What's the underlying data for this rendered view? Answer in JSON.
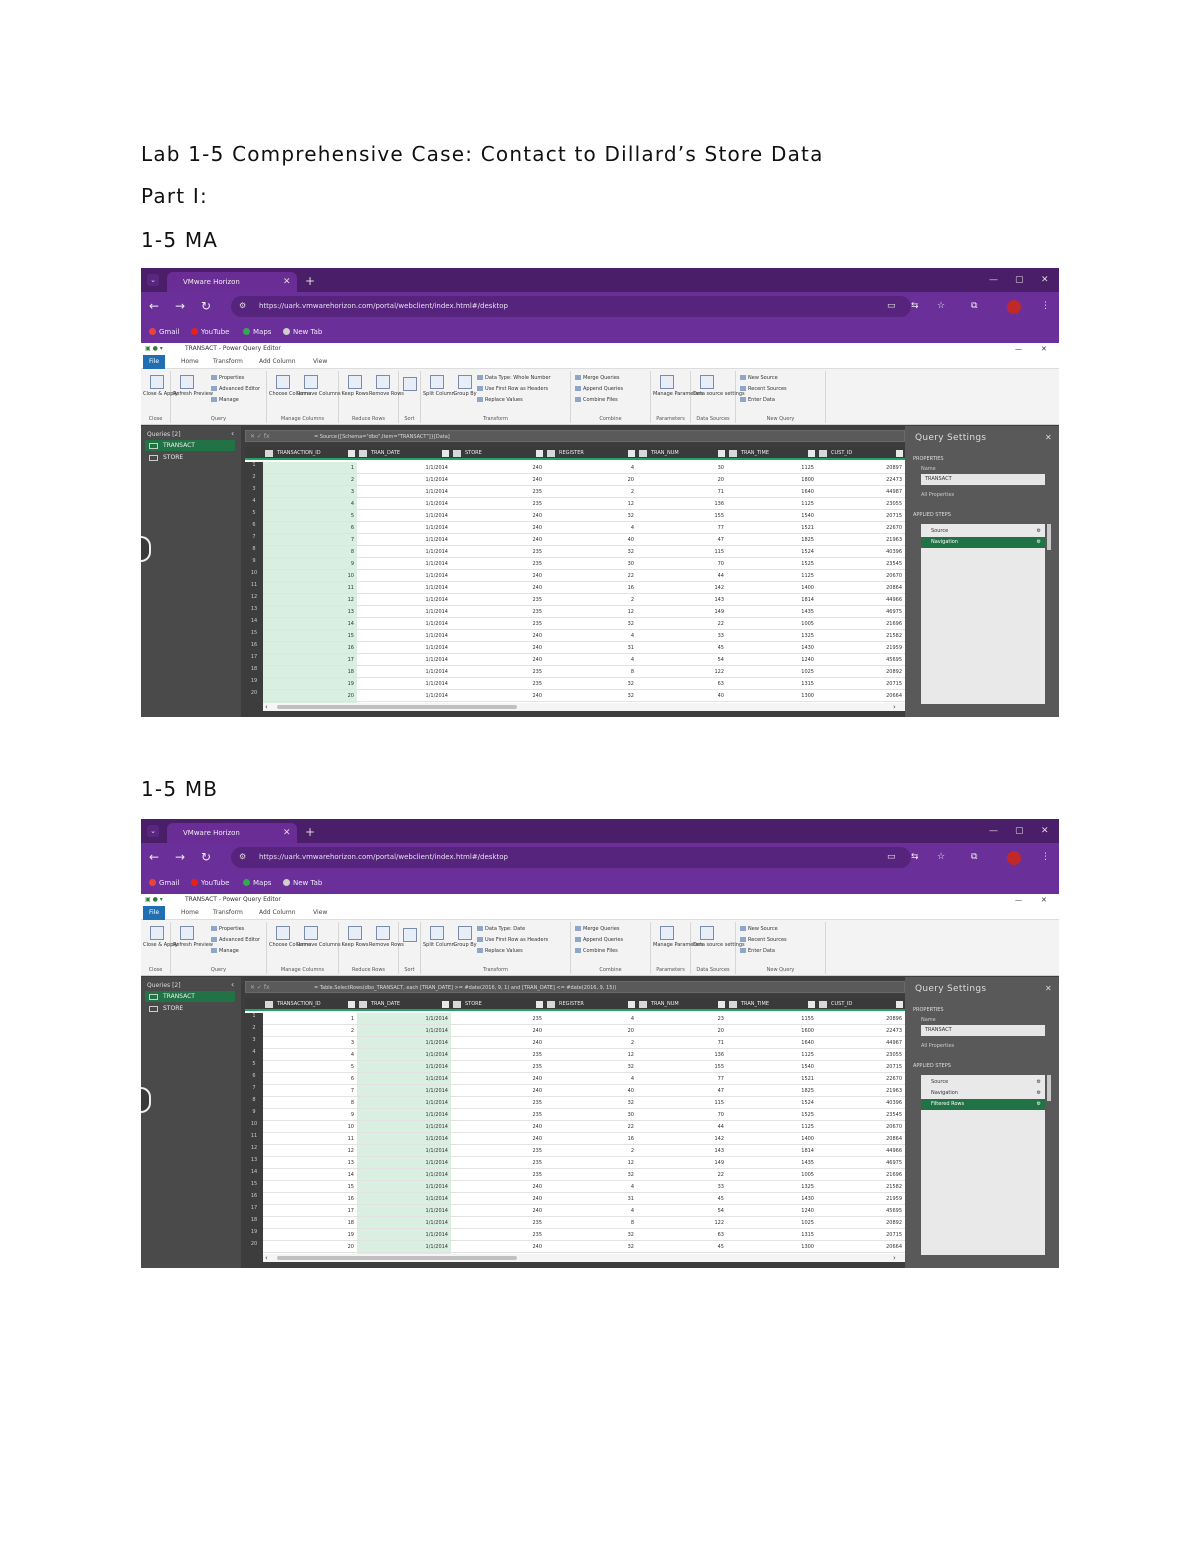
{
  "document": {
    "title": "Lab 1-5 Comprehensive Case: Contact to  Dillard’s Store Data",
    "part": "Part I:",
    "sections": [
      {
        "label": "1-5 MA"
      },
      {
        "label": "1-5 MB"
      }
    ]
  },
  "screenshots": [
    {
      "browser": {
        "tab_title": "VMware Horizon",
        "url": "https://uark.vmwarehorizon.com/portal/webclient/index.html#/desktop",
        "bookmarks": [
          "Gmail",
          "YouTube",
          "Maps",
          "New Tab"
        ]
      },
      "app": {
        "window_title": "TRANSACT - Power Query Editor",
        "ribbon_tabs": [
          "File",
          "Home",
          "Transform",
          "Add Column",
          "View"
        ],
        "ribbon_groups": [
          {
            "label": "Close",
            "buttons": [
              "Close & Apply"
            ]
          },
          {
            "label": "Query",
            "buttons": [
              "Refresh Preview",
              "Properties",
              "Advanced Editor",
              "Manage"
            ]
          },
          {
            "label": "Manage Columns",
            "buttons": [
              "Choose Columns",
              "Remove Columns"
            ]
          },
          {
            "label": "Reduce Rows",
            "buttons": [
              "Keep Rows",
              "Remove Rows"
            ]
          },
          {
            "label": "Sort",
            "buttons": []
          },
          {
            "label": "Transform",
            "buttons": [
              "Split Column",
              "Group By",
              "Data Type: Whole Number",
              "Use First Row as Headers",
              "Replace Values"
            ]
          },
          {
            "label": "Combine",
            "buttons": [
              "Merge Queries",
              "Append Queries",
              "Combine Files"
            ]
          },
          {
            "label": "Parameters",
            "buttons": [
              "Manage Parameters"
            ]
          },
          {
            "label": "Data Sources",
            "buttons": [
              "Data source settings"
            ]
          },
          {
            "label": "New Query",
            "buttons": [
              "New Source",
              "Recent Sources",
              "Enter Data"
            ]
          }
        ],
        "queries_header": "Queries [2]",
        "queries": [
          "TRANSACT",
          "STORE"
        ],
        "selected_query": "TRANSACT",
        "formula": "= Source{[Schema=\"dbo\",Item=\"TRANSACT\"]}[Data]",
        "columns": [
          "TRANSACTION_ID",
          "TRAN_DATE",
          "STORE",
          "REGISTER",
          "TRAN_NUM",
          "TRAN_TIME",
          "CUST_ID"
        ],
        "selected_column": "TRANSACTION_ID",
        "rows": [
          [
            "1",
            "1/1/2014",
            "240",
            "4",
            "30",
            "1125",
            "20897"
          ],
          [
            "2",
            "1/1/2014",
            "240",
            "20",
            "20",
            "1800",
            "22473"
          ],
          [
            "3",
            "1/1/2014",
            "235",
            "2",
            "71",
            "1640",
            "44987"
          ],
          [
            "4",
            "1/1/2014",
            "235",
            "12",
            "136",
            "1125",
            "23055"
          ],
          [
            "5",
            "1/1/2014",
            "240",
            "32",
            "155",
            "1540",
            "20715"
          ],
          [
            "6",
            "1/1/2014",
            "240",
            "4",
            "77",
            "1521",
            "22670"
          ],
          [
            "7",
            "1/1/2014",
            "240",
            "40",
            "47",
            "1825",
            "21963"
          ],
          [
            "8",
            "1/1/2014",
            "235",
            "32",
            "115",
            "1524",
            "40396"
          ],
          [
            "9",
            "1/1/2014",
            "235",
            "30",
            "70",
            "1525",
            "23545"
          ],
          [
            "10",
            "1/1/2014",
            "240",
            "22",
            "44",
            "1125",
            "20670"
          ],
          [
            "11",
            "1/1/2014",
            "240",
            "16",
            "142",
            "1400",
            "20864"
          ],
          [
            "12",
            "1/1/2014",
            "235",
            "2",
            "143",
            "1814",
            "44966"
          ],
          [
            "13",
            "1/1/2014",
            "235",
            "12",
            "149",
            "1435",
            "46975"
          ],
          [
            "14",
            "1/1/2014",
            "235",
            "32",
            "22",
            "1005",
            "21696"
          ],
          [
            "15",
            "1/1/2014",
            "240",
            "4",
            "33",
            "1325",
            "21582"
          ],
          [
            "16",
            "1/1/2014",
            "240",
            "31",
            "45",
            "1430",
            "21959"
          ],
          [
            "17",
            "1/1/2014",
            "240",
            "4",
            "54",
            "1240",
            "45695"
          ],
          [
            "18",
            "1/1/2014",
            "235",
            "8",
            "122",
            "1025",
            "20892"
          ],
          [
            "19",
            "1/1/2014",
            "235",
            "32",
            "63",
            "1315",
            "20715"
          ],
          [
            "20",
            "1/1/2014",
            "240",
            "32",
            "40",
            "1300",
            "20664"
          ]
        ],
        "settings": {
          "title": "Query Settings",
          "properties_label": "PROPERTIES",
          "name_label": "Name",
          "name_value": "TRANSACT",
          "all_properties": "All Properties",
          "applied_steps_label": "APPLIED STEPS",
          "steps": [
            "Source",
            "Navigation"
          ],
          "selected_step": "Navigation"
        }
      }
    },
    {
      "browser": {
        "tab_title": "VMware Horizon",
        "url": "https://uark.vmwarehorizon.com/portal/webclient/index.html#/desktop",
        "bookmarks": [
          "Gmail",
          "YouTube",
          "Maps",
          "New Tab"
        ]
      },
      "app": {
        "window_title": "TRANSACT - Power Query Editor",
        "ribbon_tabs": [
          "File",
          "Home",
          "Transform",
          "Add Column",
          "View"
        ],
        "ribbon_groups": [
          {
            "label": "Close",
            "buttons": [
              "Close & Apply"
            ]
          },
          {
            "label": "Query",
            "buttons": [
              "Refresh Preview",
              "Properties",
              "Advanced Editor",
              "Manage"
            ]
          },
          {
            "label": "Manage Columns",
            "buttons": [
              "Choose Columns",
              "Remove Columns"
            ]
          },
          {
            "label": "Reduce Rows",
            "buttons": [
              "Keep Rows",
              "Remove Rows"
            ]
          },
          {
            "label": "Sort",
            "buttons": []
          },
          {
            "label": "Transform",
            "buttons": [
              "Split Column",
              "Group By",
              "Data Type: Date",
              "Use First Row as Headers",
              "Replace Values"
            ]
          },
          {
            "label": "Combine",
            "buttons": [
              "Merge Queries",
              "Append Queries",
              "Combine Files"
            ]
          },
          {
            "label": "Parameters",
            "buttons": [
              "Manage Parameters"
            ]
          },
          {
            "label": "Data Sources",
            "buttons": [
              "Data source settings"
            ]
          },
          {
            "label": "New Query",
            "buttons": [
              "New Source",
              "Recent Sources",
              "Enter Data"
            ]
          }
        ],
        "queries_header": "Queries [2]",
        "queries": [
          "TRANSACT",
          "STORE"
        ],
        "selected_query": "TRANSACT",
        "formula": "= Table.SelectRows(dbo_TRANSACT, each [TRAN_DATE] >= #date(2016, 9, 1) and [TRAN_DATE] <= #date(2016, 9, 15))",
        "columns": [
          "TRANSACTION_ID",
          "TRAN_DATE",
          "STORE",
          "REGISTER",
          "TRAN_NUM",
          "TRAN_TIME",
          "CUST_ID"
        ],
        "selected_column": "TRAN_DATE",
        "rows": [
          [
            "1",
            "1/1/2014",
            "235",
            "4",
            "23",
            "1155",
            "20896"
          ],
          [
            "2",
            "1/1/2014",
            "240",
            "20",
            "20",
            "1600",
            "22473"
          ],
          [
            "3",
            "1/1/2014",
            "240",
            "2",
            "71",
            "1640",
            "44967"
          ],
          [
            "4",
            "1/1/2014",
            "235",
            "12",
            "136",
            "1125",
            "23055"
          ],
          [
            "5",
            "1/1/2014",
            "235",
            "32",
            "155",
            "1540",
            "20715"
          ],
          [
            "6",
            "1/1/2014",
            "240",
            "4",
            "77",
            "1521",
            "22670"
          ],
          [
            "7",
            "1/1/2014",
            "240",
            "40",
            "47",
            "1825",
            "21963"
          ],
          [
            "8",
            "1/1/2014",
            "235",
            "32",
            "115",
            "1524",
            "40396"
          ],
          [
            "9",
            "1/1/2014",
            "235",
            "30",
            "70",
            "1525",
            "23545"
          ],
          [
            "10",
            "1/1/2014",
            "240",
            "22",
            "44",
            "1125",
            "20670"
          ],
          [
            "11",
            "1/1/2014",
            "240",
            "16",
            "142",
            "1400",
            "20864"
          ],
          [
            "12",
            "1/1/2014",
            "235",
            "2",
            "143",
            "1814",
            "44966"
          ],
          [
            "13",
            "1/1/2014",
            "235",
            "12",
            "149",
            "1435",
            "46975"
          ],
          [
            "14",
            "1/1/2014",
            "235",
            "32",
            "22",
            "1005",
            "21696"
          ],
          [
            "15",
            "1/1/2014",
            "240",
            "4",
            "33",
            "1325",
            "21582"
          ],
          [
            "16",
            "1/1/2014",
            "240",
            "31",
            "45",
            "1430",
            "21959"
          ],
          [
            "17",
            "1/1/2014",
            "240",
            "4",
            "54",
            "1240",
            "45695"
          ],
          [
            "18",
            "1/1/2014",
            "235",
            "8",
            "122",
            "1025",
            "20892"
          ],
          [
            "19",
            "1/1/2014",
            "235",
            "32",
            "63",
            "1315",
            "20715"
          ],
          [
            "20",
            "1/1/2014",
            "240",
            "32",
            "45",
            "1300",
            "20664"
          ]
        ],
        "settings": {
          "title": "Query Settings",
          "properties_label": "PROPERTIES",
          "name_label": "Name",
          "name_value": "TRANSACT",
          "all_properties": "All Properties",
          "applied_steps_label": "APPLIED STEPS",
          "steps": [
            "Source",
            "Navigation",
            "Filtered Rows"
          ],
          "selected_step": "Filtered Rows"
        }
      }
    }
  ]
}
